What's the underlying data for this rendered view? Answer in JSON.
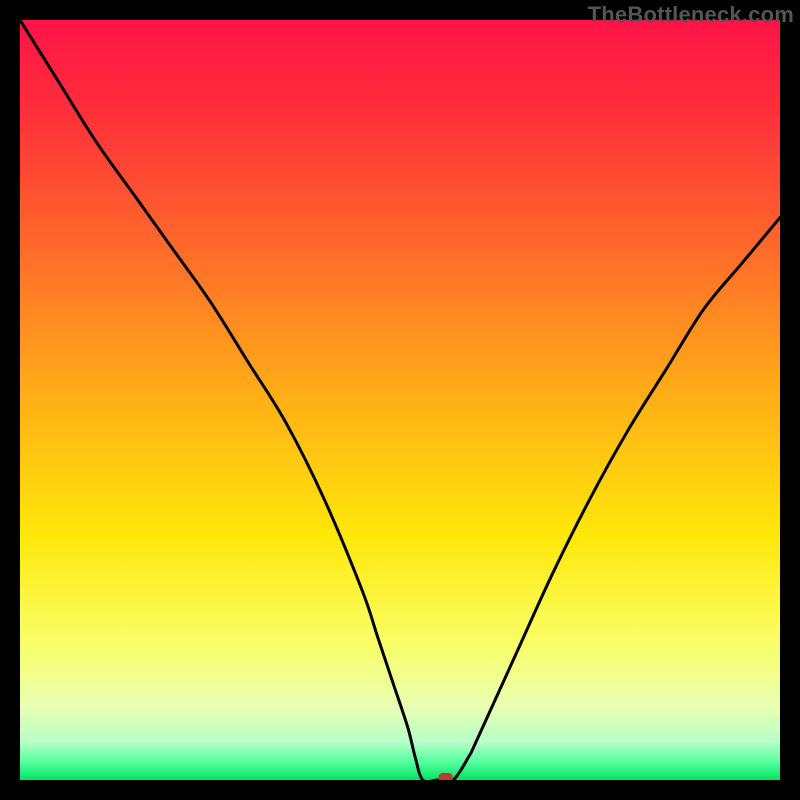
{
  "attribution": "TheBottleneck.com",
  "chart_data": {
    "type": "line",
    "title": "",
    "xlabel": "",
    "ylabel": "",
    "xlim": [
      0,
      100
    ],
    "ylim": [
      0,
      100
    ],
    "background": {
      "type": "vertical-gradient",
      "stops": [
        {
          "pos": 0.0,
          "color": "#ff1447"
        },
        {
          "pos": 0.12,
          "color": "#ff2e3a"
        },
        {
          "pos": 0.3,
          "color": "#ff6a2a"
        },
        {
          "pos": 0.5,
          "color": "#ffb016"
        },
        {
          "pos": 0.68,
          "color": "#ffe80a"
        },
        {
          "pos": 0.82,
          "color": "#f8ff66"
        },
        {
          "pos": 0.9,
          "color": "#eaffb0"
        },
        {
          "pos": 0.95,
          "color": "#b8ffc8"
        },
        {
          "pos": 0.975,
          "color": "#5affa0"
        },
        {
          "pos": 1.0,
          "color": "#00e564"
        }
      ]
    },
    "series": [
      {
        "name": "bottleneck-curve",
        "color": "#000000",
        "x": [
          0,
          5,
          10,
          15,
          20,
          25,
          30,
          35,
          40,
          45,
          47,
          49,
          51,
          52,
          53,
          55,
          57,
          59,
          60,
          65,
          70,
          75,
          80,
          85,
          90,
          95,
          100
        ],
        "y": [
          100,
          92,
          84,
          77,
          70,
          63,
          55,
          47,
          37,
          25,
          19,
          13,
          7,
          3,
          0,
          0,
          0,
          3,
          5,
          16,
          27,
          37,
          46,
          54,
          62,
          68,
          74
        ]
      }
    ],
    "marker": {
      "name": "optimal-point",
      "x": 56,
      "y": 0,
      "color": "#c0392b",
      "shape": "rounded-rect"
    }
  }
}
